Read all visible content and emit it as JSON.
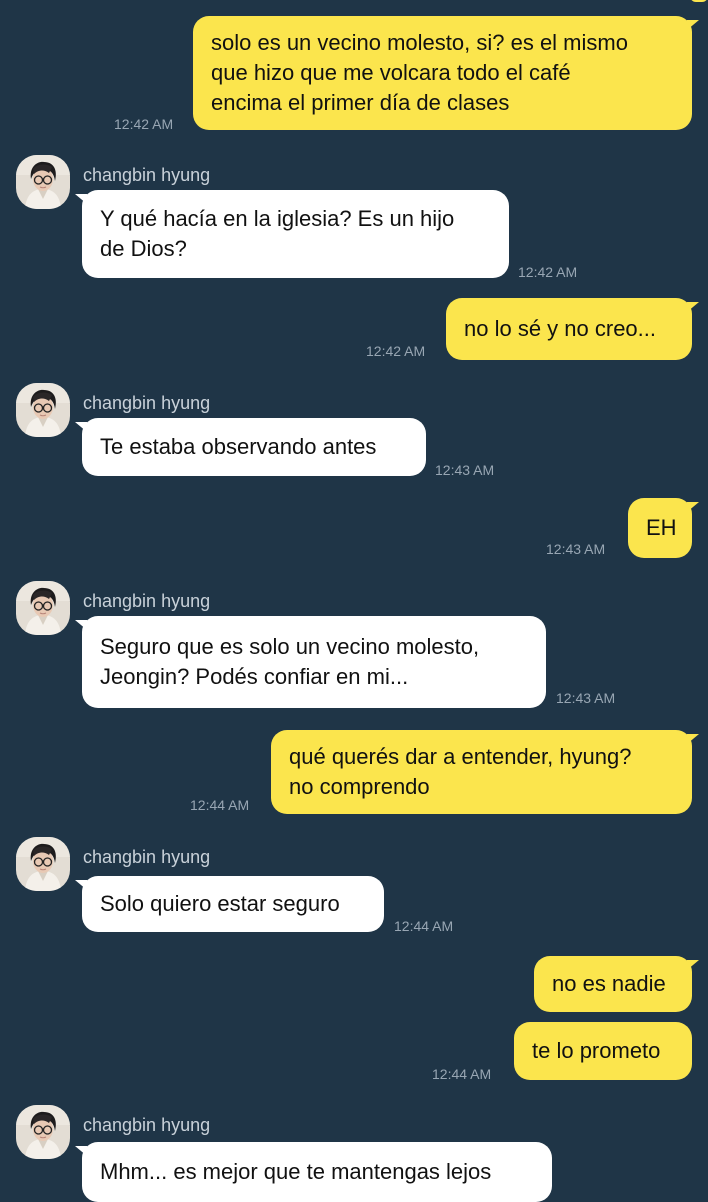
{
  "colors": {
    "background": "#1f3547",
    "my_bubble": "#fbe54d",
    "their_bubble": "#ffffff",
    "timestamp": "#98a6b3",
    "sender_name": "#c8d1d9"
  },
  "contact": {
    "name": "changbin hyung",
    "avatar_icon": "profile-photo-avatar-icon"
  },
  "messages": [
    {
      "from": "me",
      "lines": [
        "solo es un vecino molesto, si? es el mismo",
        "que hizo que me volcara todo el café",
        "encima el primer día de clases"
      ],
      "time": "12:42 AM"
    },
    {
      "from": "them",
      "sender": "changbin hyung",
      "lines": [
        "Y qué hacía en la iglesia? Es un hijo",
        "de Dios?"
      ],
      "time": "12:42 AM"
    },
    {
      "from": "me",
      "lines": [
        "no lo sé y no creo..."
      ],
      "time": "12:42 AM"
    },
    {
      "from": "them",
      "sender": "changbin hyung",
      "lines": [
        "Te estaba observando antes"
      ],
      "time": "12:43 AM"
    },
    {
      "from": "me",
      "lines": [
        "EH"
      ],
      "time": "12:43 AM"
    },
    {
      "from": "them",
      "sender": "changbin hyung",
      "lines": [
        "Seguro que es solo un vecino molesto,",
        "Jeongin? Podés confiar en mi..."
      ],
      "time": "12:43 AM"
    },
    {
      "from": "me",
      "lines": [
        "qué querés dar a entender, hyung?",
        "no comprendo"
      ],
      "time": "12:44 AM"
    },
    {
      "from": "them",
      "sender": "changbin hyung",
      "lines": [
        "Solo quiero estar seguro"
      ],
      "time": "12:44 AM"
    },
    {
      "from": "me",
      "lines": [
        "no es nadie"
      ]
    },
    {
      "from": "me",
      "lines": [
        "te lo prometo"
      ],
      "time": "12:44 AM"
    },
    {
      "from": "them",
      "sender": "changbin hyung",
      "lines": [
        "Mhm... es mejor que te mantengas lejos"
      ]
    }
  ]
}
